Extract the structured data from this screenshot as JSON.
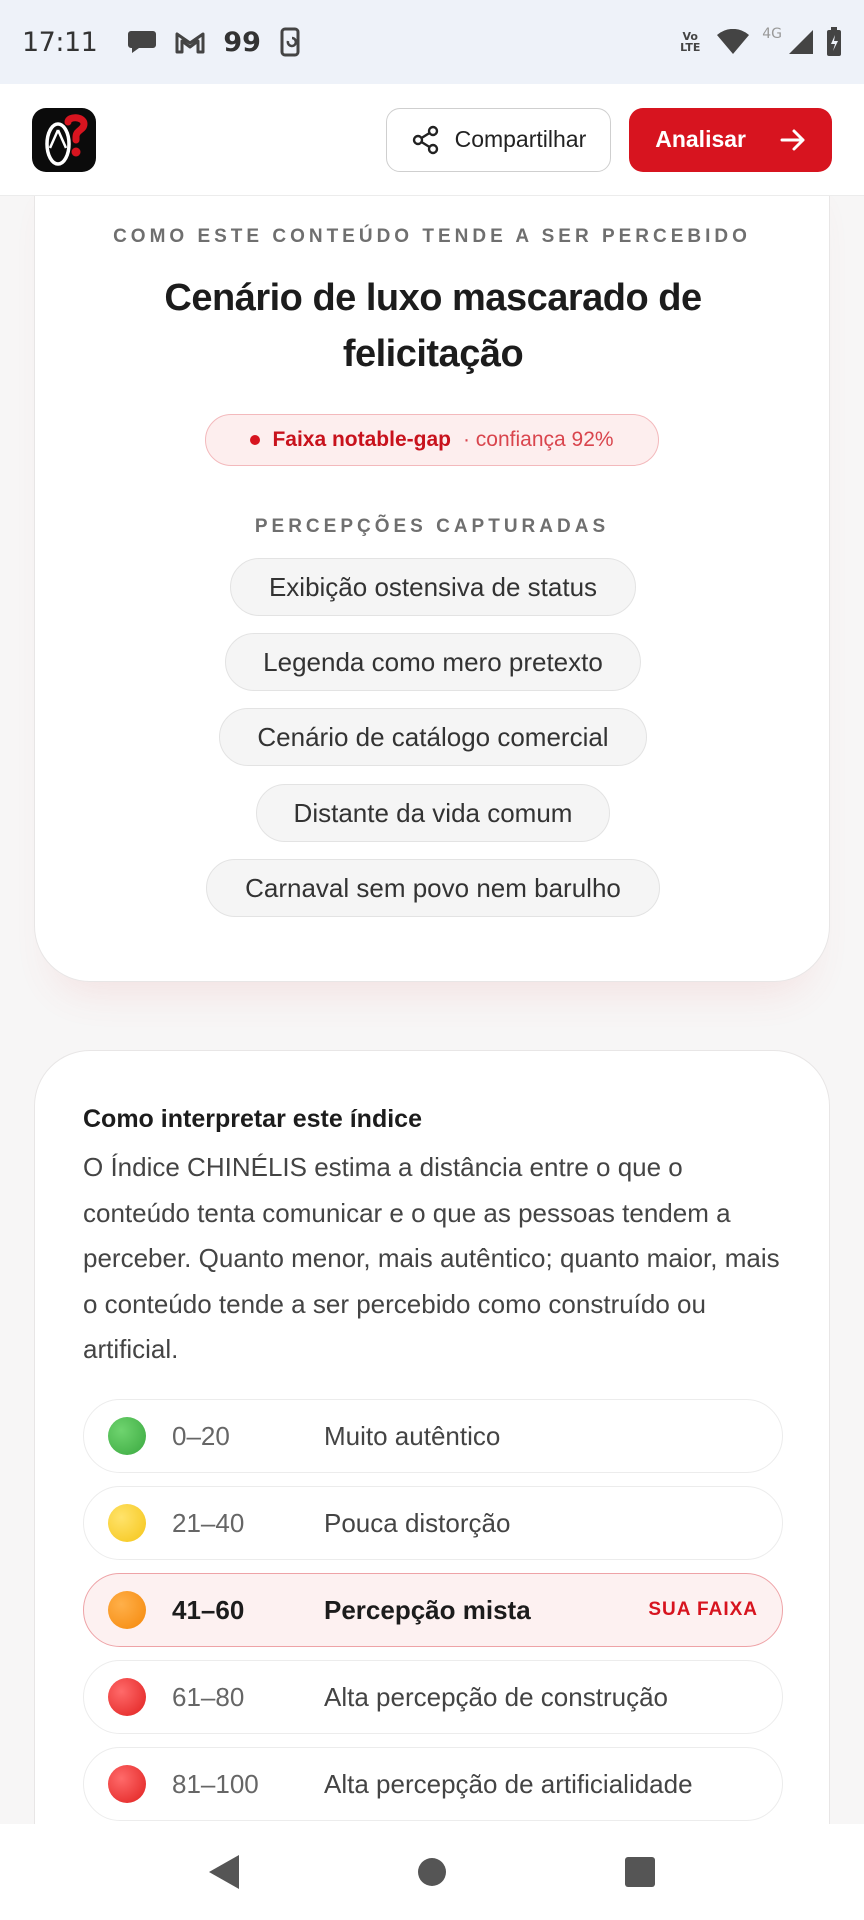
{
  "status_bar": {
    "time": "17:11",
    "quote_count": "99",
    "network_label": "4G",
    "lte_label": "Vo LTE"
  },
  "header": {
    "share_label": "Compartilhar",
    "analyze_label": "Analisar"
  },
  "perception_card": {
    "eyebrow": "COMO ESTE CONTEÚDO TENDE A SER PERCEBIDO",
    "title_line1": "Cenário de luxo mascarado de",
    "title_line2": "felicitação",
    "band_label": "Faixa notable-gap",
    "band_confidence": "· confiança 92%",
    "captured_title": "PERCEPÇÕES CAPTURADAS",
    "chips": [
      "Exibição ostensiva de status",
      "Legenda como mero pretexto",
      "Cenário de catálogo comercial",
      "Distante da vida comum",
      "Carnaval sem povo nem barulho"
    ]
  },
  "interpretation_card": {
    "title": "Como interpretar este índice",
    "body": "O Índice CHINÉLIS estima a distância entre o que o conteúdo tenta comunicar e o que as pessoas tendem a perceber. Quanto menor, mais autêntico; quanto maior, mais o conteúdo tende a ser percebido como construído ou artificial.",
    "ranges": [
      {
        "range": "0–20",
        "label": "Muito autêntico",
        "color": "#3aa83f",
        "badge": ""
      },
      {
        "range": "21–40",
        "label": "Pouca distorção",
        "color": "#f5c518",
        "badge": ""
      },
      {
        "range": "41–60",
        "label": "Percepção mista",
        "color": "#f5880a",
        "badge": "SUA FAIXA"
      },
      {
        "range": "61–80",
        "label": "Alta percepção de construção",
        "color": "#e0201f",
        "badge": ""
      },
      {
        "range": "81–100",
        "label": "Alta percepção de artificialidade",
        "color": "#e0201f",
        "badge": ""
      }
    ]
  },
  "colors": {
    "accent": "#d7141f",
    "active_row_bg": "#fdf1f1"
  }
}
